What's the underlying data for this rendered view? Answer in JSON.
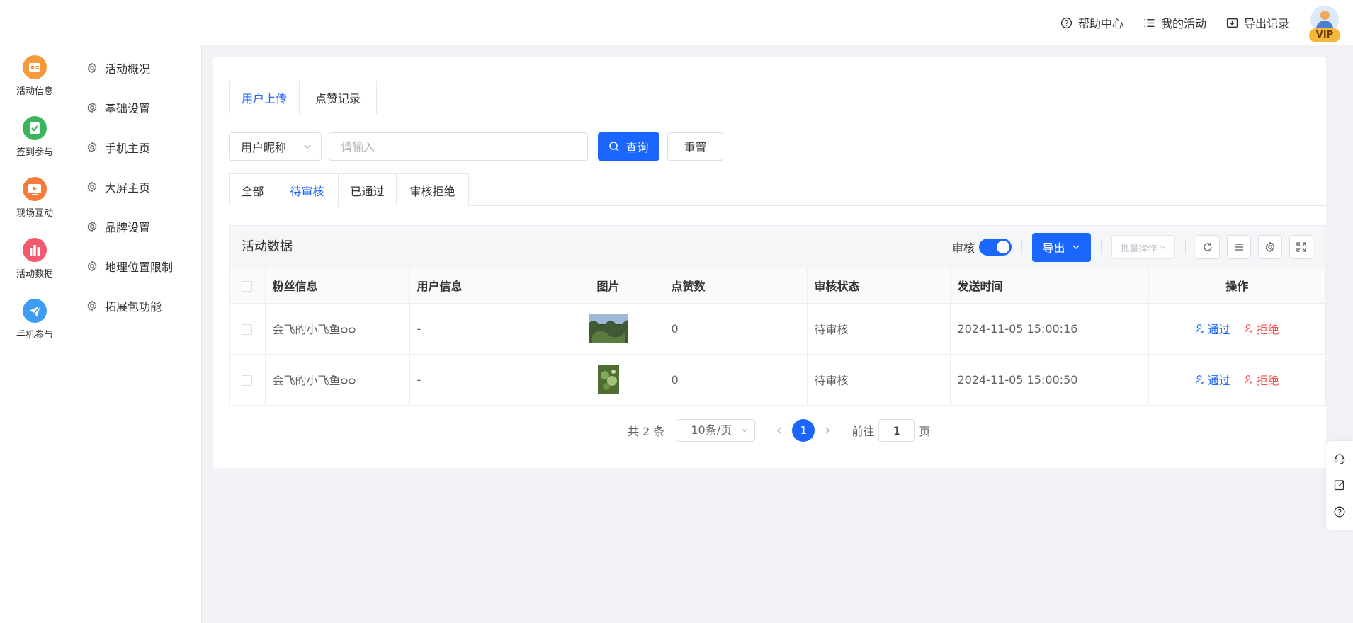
{
  "header": {
    "links": [
      {
        "label": "帮助中心",
        "icon": "help-circle-icon"
      },
      {
        "label": "我的活动",
        "icon": "list-icon"
      },
      {
        "label": "导出记录",
        "icon": "download-box-icon"
      }
    ],
    "vip_badge": "VIP"
  },
  "leftnav": {
    "items": [
      {
        "label": "活动信息",
        "icon": "activity-info-icon",
        "color": "#f59a3c"
      },
      {
        "label": "签到参与",
        "icon": "checkin-icon",
        "color": "#3bb55f"
      },
      {
        "label": "现场互动",
        "icon": "live-interaction-icon",
        "color": "#f57b3a"
      },
      {
        "label": "活动数据",
        "icon": "activity-data-icon",
        "color": "#f2596e"
      },
      {
        "label": "手机参与",
        "icon": "mobile-join-icon",
        "color": "#3d9df2"
      }
    ]
  },
  "subnav": {
    "items": [
      {
        "label": "活动概况"
      },
      {
        "label": "基础设置"
      },
      {
        "label": "手机主页"
      },
      {
        "label": "大屏主页"
      },
      {
        "label": "品牌设置"
      },
      {
        "label": "地理位置限制"
      },
      {
        "label": "拓展包功能"
      }
    ]
  },
  "tabs": {
    "upload": "用户上传",
    "likes": "点赞记录",
    "active": "upload"
  },
  "search": {
    "field_select": "用户昵称",
    "placeholder": "请输入",
    "value": "",
    "query_label": "查询",
    "reset_label": "重置"
  },
  "status_tabs": {
    "all": "全部",
    "pending": "待审核",
    "approved": "已通过",
    "rejected": "审核拒绝",
    "active": "pending"
  },
  "table": {
    "title": "活动数据",
    "audit_label": "审核",
    "audit_on": true,
    "export_label": "导出",
    "batch_label": "批量操作",
    "columns": [
      "粉丝信息",
      "用户信息",
      "图片",
      "点赞数",
      "审核状态",
      "发送时间",
      "操作"
    ],
    "rows": [
      {
        "fan": "会飞的小飞鱼ᴑᴑ",
        "user": "-",
        "likes": "0",
        "status": "待审核",
        "time": "2024-11-05 15:00:16",
        "pass": "通过",
        "reject": "拒绝"
      },
      {
        "fan": "会飞的小飞鱼ᴑᴑ",
        "user": "-",
        "likes": "0",
        "status": "待审核",
        "time": "2024-11-05 15:00:50",
        "pass": "通过",
        "reject": "拒绝"
      }
    ]
  },
  "pagination": {
    "total": "共 2 条",
    "page_size": "10条/页",
    "current": "1",
    "goto_label": "前往",
    "goto_value": "1",
    "page_suffix": "页"
  },
  "colors": {
    "primary": "#1a66ff",
    "danger": "#f0504a"
  }
}
